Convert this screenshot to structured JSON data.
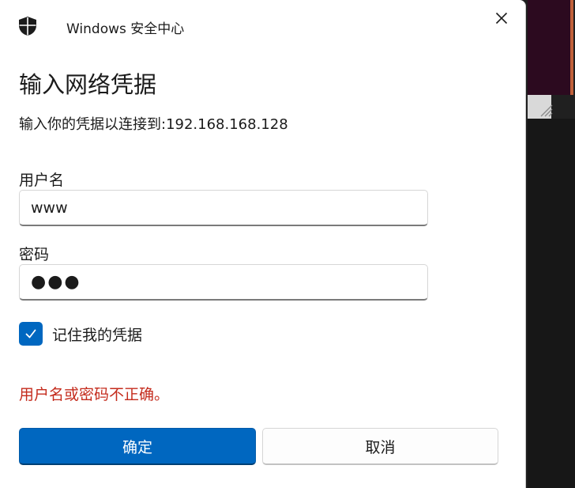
{
  "dialog": {
    "app_title": "Windows 安全中心",
    "heading": "输入网络凭据",
    "subtext": "输入你的凭据以连接到:192.168.168.128",
    "username": {
      "label": "用户名",
      "value": "www"
    },
    "password": {
      "label": "密码",
      "value": "●●●"
    },
    "remember": {
      "label": "记住我的凭据",
      "checked": true
    },
    "error": "用户名或密码不正确。",
    "ok_label": "确定",
    "cancel_label": "取消"
  },
  "icons": {
    "app": "shield-icon",
    "close": "close-icon",
    "check": "checkmark-icon",
    "resize": "resize-grip-icon"
  },
  "colors": {
    "accent": "#0067c0",
    "error": "#c42b1c",
    "background_terminal": "#2c0a1f"
  }
}
